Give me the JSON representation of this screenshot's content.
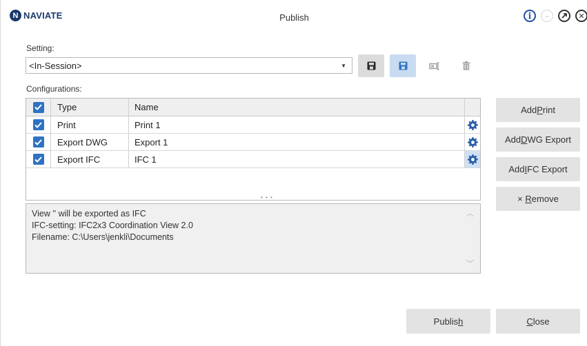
{
  "titlebar": {
    "logo_letter": "N",
    "logo_text": "NAVIATE",
    "title": "Publish",
    "icons": [
      "info-icon",
      "minimize-icon",
      "restore-icon",
      "close-icon"
    ]
  },
  "setting": {
    "label": "Setting:",
    "value": "<In-Session>",
    "toolbar_icons": [
      "save-icon",
      "save-as-icon",
      "rename-icon",
      "delete-icon"
    ]
  },
  "configurations": {
    "label": "Configurations:",
    "headers": {
      "type": "Type",
      "name": "Name"
    },
    "rows": [
      {
        "checked": true,
        "type": "Print",
        "name": "Print 1"
      },
      {
        "checked": true,
        "type": "Export DWG",
        "name": "Export 1"
      },
      {
        "checked": true,
        "type": "Export IFC",
        "name": "IFC 1"
      }
    ],
    "splitter": "• • •"
  },
  "info": {
    "lines": [
      "View '' will be exported as IFC",
      "IFC-setting: IFC2x3 Coordination View 2.0",
      "Filename: C:\\Users\\jenkli\\Documents"
    ]
  },
  "actions": {
    "add_print": {
      "pre": "Add ",
      "key": "P",
      "post": "rint"
    },
    "add_dwg": {
      "pre": "Add ",
      "key": "D",
      "post": "WG Export"
    },
    "add_ifc": {
      "pre": "Add ",
      "key": "I",
      "post": "FC Export"
    },
    "remove": {
      "icon": "×",
      "pre": " ",
      "key": "R",
      "post": "emove"
    }
  },
  "footer": {
    "publish": {
      "pre": "Publis",
      "key": "h",
      "post": ""
    },
    "close": {
      "pre": "",
      "key": "C",
      "post": "lose"
    }
  },
  "colors": {
    "accent": "#2f72c3",
    "button_bg": "#e3e3e3",
    "dark_button": "#d8d8d8",
    "blue_button": "#c9dbf0"
  }
}
